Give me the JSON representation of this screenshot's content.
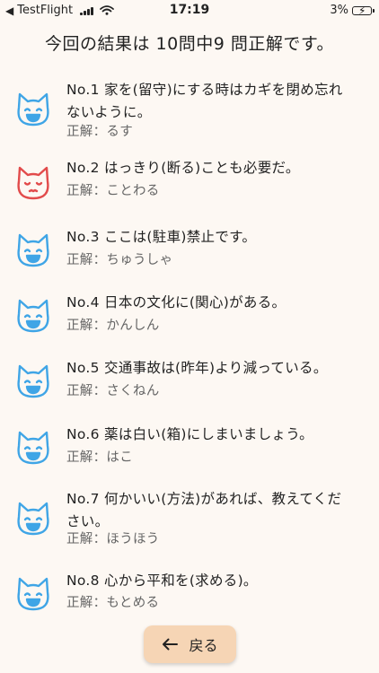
{
  "status_bar": {
    "back_label": "TestFlight",
    "time": "17:19",
    "battery": "3%"
  },
  "summary": "今回の結果は 10問中9 問正解です。",
  "colors": {
    "correct_icon": "#3fa5e6",
    "wrong_icon": "#e24b4b",
    "button_bg": "#f6d5b5",
    "background": "#fdf8f3"
  },
  "results": [
    {
      "question": "No.1  家を(留守)にする時はカギを閉め忘れないように。",
      "answer": "正解：るす",
      "status": "correct",
      "icon": "happy-cat-icon"
    },
    {
      "question": "No.2  はっきり(断る)ことも必要だ。",
      "answer": "正解：ことわる",
      "status": "wrong",
      "icon": "sad-cat-icon"
    },
    {
      "question": "No.3  ここは(駐車)禁止です。",
      "answer": "正解：ちゅうしゃ",
      "status": "correct",
      "icon": "happy-cat-icon"
    },
    {
      "question": "No.4  日本の文化に(関心)がある。",
      "answer": "正解：かんしん",
      "status": "correct",
      "icon": "happy-cat-icon"
    },
    {
      "question": "No.5  交通事故は(昨年)より減っている。",
      "answer": "正解：さくねん",
      "status": "correct",
      "icon": "happy-cat-icon"
    },
    {
      "question": "No.6  薬は白い(箱)にしまいましょう。",
      "answer": "正解：はこ",
      "status": "correct",
      "icon": "happy-cat-icon"
    },
    {
      "question": "No.7  何かいい(方法)があれば、教えてください。",
      "answer": "正解：ほうほう",
      "status": "correct",
      "icon": "happy-cat-icon"
    },
    {
      "question": "No.8  心から平和を(求める)。",
      "answer": "正解：もとめる",
      "status": "correct",
      "icon": "happy-cat-icon"
    }
  ],
  "back_button": {
    "label": "戻る",
    "icon": "arrow-left-icon"
  }
}
